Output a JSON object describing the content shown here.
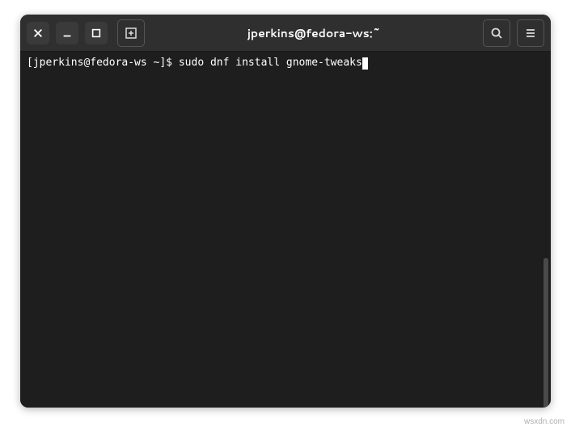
{
  "titlebar": {
    "title": "jperkins@fedora-ws:~",
    "icons": {
      "close": "close-icon",
      "minimize": "minimize-icon",
      "maximize": "maximize-icon",
      "new_tab": "new-tab-icon",
      "search": "search-icon",
      "menu": "hamburger-menu-icon"
    }
  },
  "terminal": {
    "prompt": "[jperkins@fedora-ws ~]$ ",
    "command": "sudo dnf install gnome-tweaks"
  },
  "watermark": "wsxdn.com"
}
